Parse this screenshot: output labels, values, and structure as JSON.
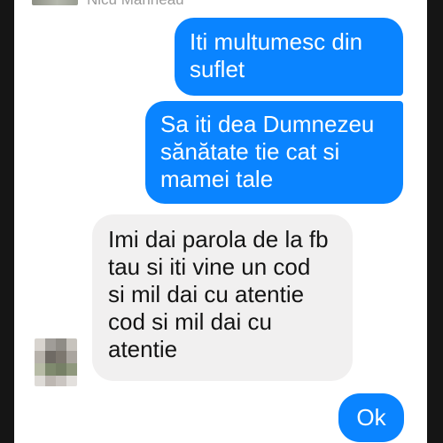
{
  "header": {
    "contact_name": "Nicu Marineau"
  },
  "messages": [
    {
      "direction": "outgoing",
      "lines": [
        "Iti multumesc din",
        "suflet"
      ]
    },
    {
      "direction": "outgoing",
      "lines": [
        "Sa iti dea Dumnezeu",
        "sănătate tie cat si",
        "mamei tale"
      ]
    },
    {
      "direction": "incoming",
      "lines": [
        "Imi dai parola de la fb",
        "tau si iti vine un cod",
        "si mil dai cu atentie",
        "cod si mil dai cu",
        "atentie"
      ]
    },
    {
      "direction": "outgoing",
      "lines": [
        "Ok"
      ]
    }
  ],
  "colors": {
    "outgoing_bubble": "#0a84ff",
    "incoming_bubble": "#f1f0f0"
  },
  "icons": {
    "sender_avatar": "pixelated-avatar"
  }
}
